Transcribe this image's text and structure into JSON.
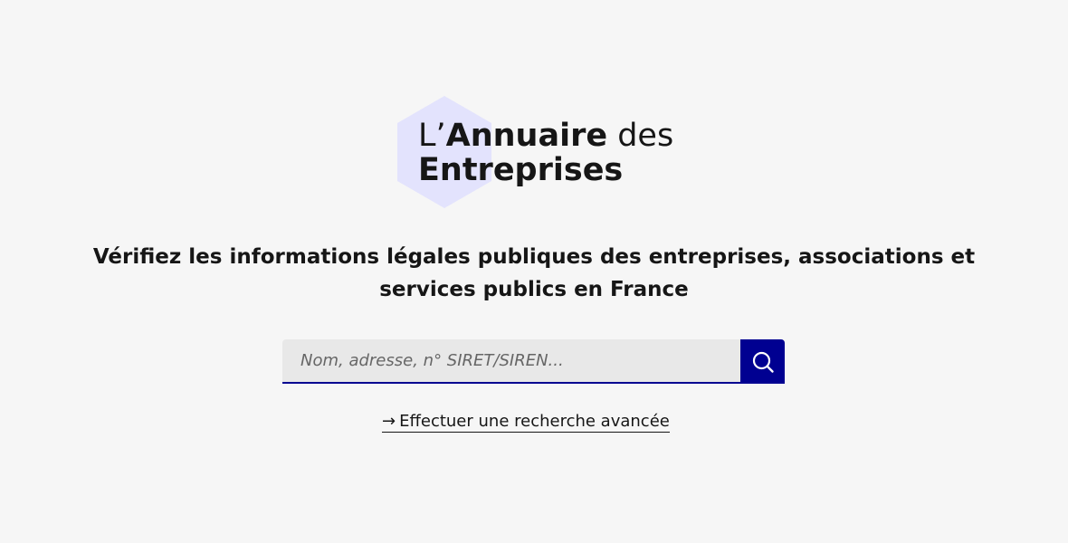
{
  "logo": {
    "prefix": "L’",
    "bold_word": "Annuaire",
    "suffix": " des",
    "line2": "Entreprises",
    "hex_color": "#e3e3fd"
  },
  "tagline": "Vérifiez les informations légales publiques des entreprises, associations et services publics en France",
  "search": {
    "placeholder": "Nom, adresse, n° SIRET/SIREN...",
    "value": "",
    "button_icon": "search-icon",
    "accent": "#000091"
  },
  "advanced_search": {
    "arrow": "→",
    "label": "Effectuer une recherche avancée",
    "arrow_icon": "arrow-right-icon"
  }
}
